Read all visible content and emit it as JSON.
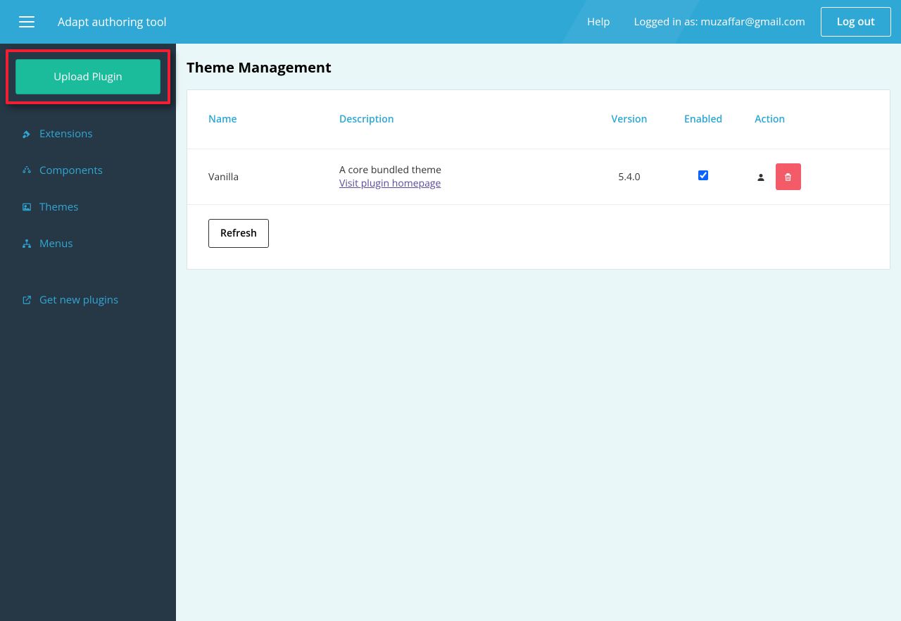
{
  "header": {
    "app_title": "Adapt authoring tool",
    "help_label": "Help",
    "logged_in_prefix": "Logged in as: ",
    "user_email": "muzaffar@gmail.com",
    "logout_label": "Log out"
  },
  "sidebar": {
    "upload_label": "Upload Plugin",
    "items": [
      {
        "label": "Extensions",
        "icon": "plug-icon"
      },
      {
        "label": "Components",
        "icon": "cubes-icon"
      },
      {
        "label": "Themes",
        "icon": "image-icon"
      },
      {
        "label": "Menus",
        "icon": "sitemap-icon"
      }
    ],
    "get_new_label": "Get new plugins"
  },
  "main": {
    "page_title": "Theme Management",
    "columns": {
      "name": "Name",
      "description": "Description",
      "version": "Version",
      "enabled": "Enabled",
      "action": "Action"
    },
    "rows": [
      {
        "name": "Vanilla",
        "description": "A core bundled theme",
        "homepage_label": "Visit plugin homepage",
        "version": "5.4.0",
        "enabled": true
      }
    ],
    "refresh_label": "Refresh"
  }
}
